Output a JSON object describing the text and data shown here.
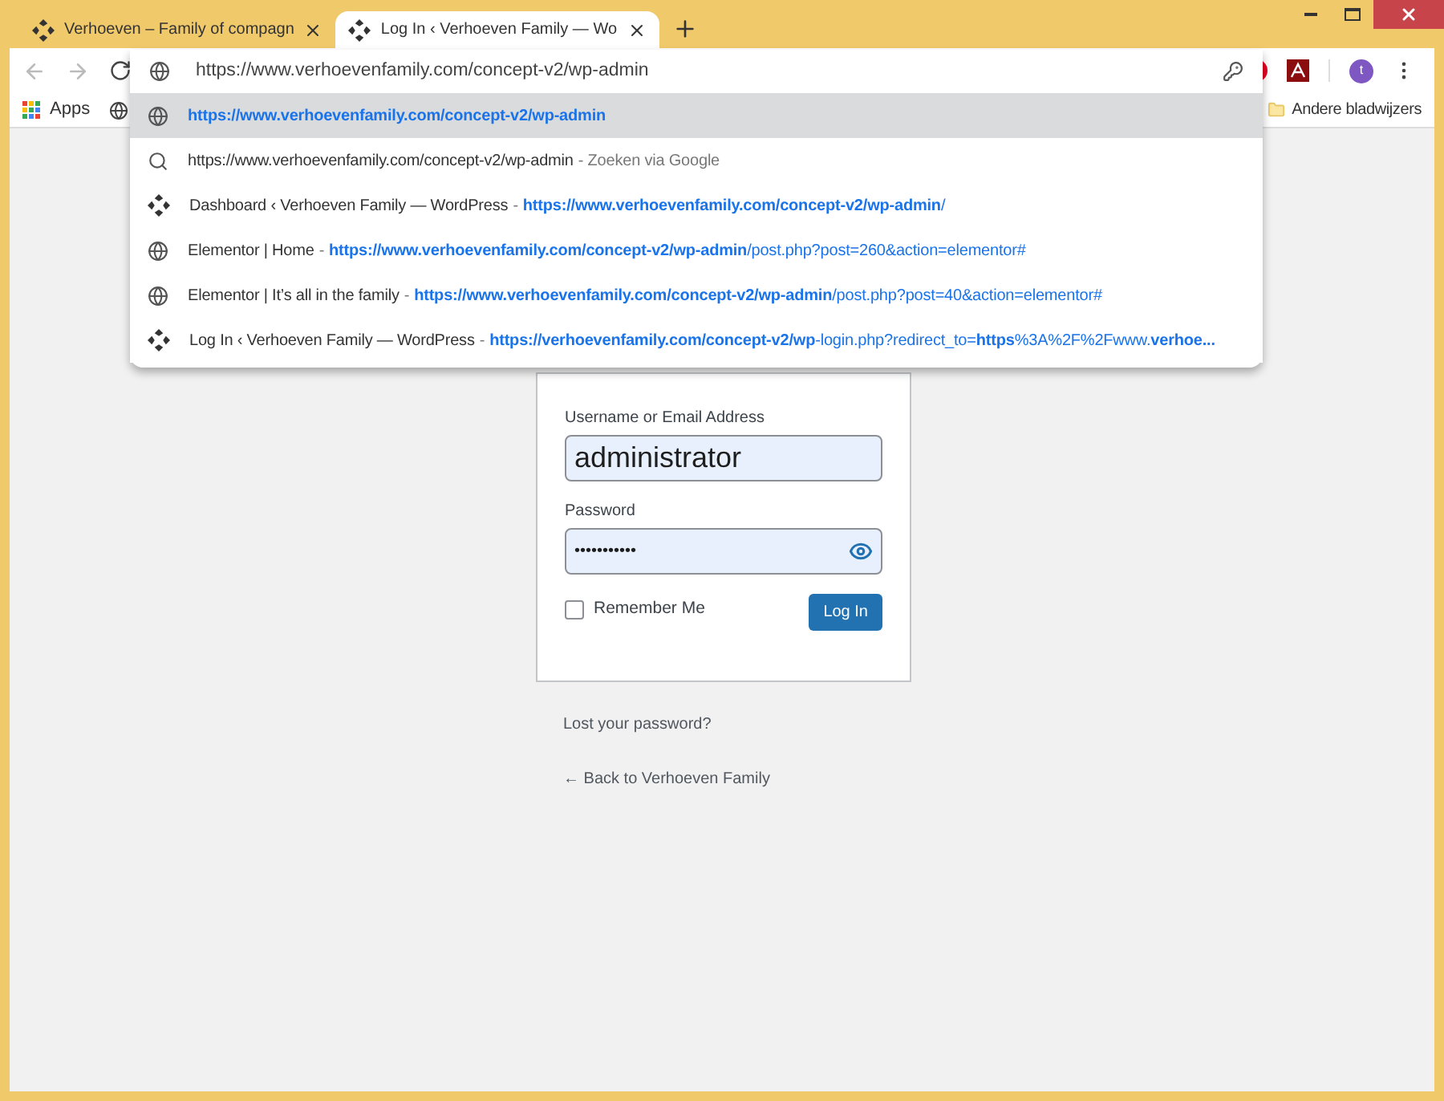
{
  "tabs": [
    {
      "title": "Verhoeven – Family of compagn",
      "selected": false
    },
    {
      "title": "Log In ‹ Verhoeven Family — Wo",
      "selected": true
    }
  ],
  "address_bar": {
    "value": "https://www.verhoevenfamily.com/concept-v2/wp-admin"
  },
  "avatar": {
    "initial": "t"
  },
  "bookmarks": [
    {
      "kind": "apps",
      "label": "Apps"
    },
    {
      "kind": "site"
    }
  ],
  "other_bookmarks": "Andere bladwijzers",
  "suggestions": [
    {
      "kind": "globe",
      "url": "**https://www.verhoevenfamily.com/concept-v2/wp-admin**",
      "selected": true
    },
    {
      "kind": "search",
      "title": "https://www.verhoevenfamily.com/concept-v2/wp-admin",
      "detail": "- Zoeken via Google",
      "selected": false
    },
    {
      "kind": "wordpress",
      "title": "Dashboard ‹ Verhoeven Family — WordPress",
      "detail": "-",
      "url": "**https://www.verhoevenfamily.com/concept-v2/wp-admin**/",
      "selected": false
    },
    {
      "kind": "globe",
      "title": "Elementor | Home",
      "detail": "-",
      "url": "**https://www.verhoevenfamily.com/concept-v2/wp-admin**/post.php?post=260&action=elementor#",
      "selected": false
    },
    {
      "kind": "globe",
      "title": "Elementor | It’s all in the family",
      "detail": "-",
      "url": "**https://www.verhoevenfamily.com/concept-v2/wp-admin**/post.php?post=40&action=elementor#",
      "selected": false
    },
    {
      "kind": "wordpress",
      "title": "Log In ‹ Verhoeven Family — WordPress",
      "detail": "-",
      "url": "**https://verhoevenfamily.com/concept-v2/wp**-login.php?redirect_to=**https**%3A%2F%2Fwww.**verhoe...**",
      "selected": false
    }
  ],
  "login": {
    "username_label": "Username or Email Address",
    "username": "administrator",
    "password_label": "Password",
    "password": "•••••••••••",
    "remember_label": "Remember Me",
    "remember_checked": false,
    "submit": "Log In"
  },
  "links": [
    "Lost your password?",
    "← Back to Verhoeven Family"
  ]
}
